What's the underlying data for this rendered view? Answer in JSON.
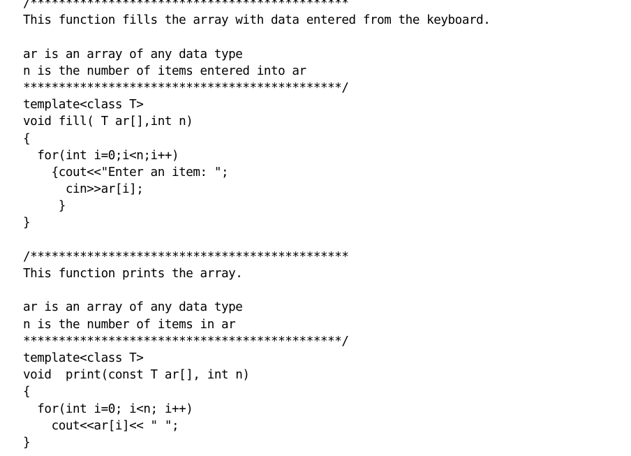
{
  "document": {
    "kind": "source-code-listing",
    "language": "C++",
    "background_color": "#ffffff",
    "text_color": "#000000",
    "lines": [
      "/*********************************************",
      "This function fills the array with data entered from the keyboard.",
      "",
      "ar is an array of any data type",
      "n is the number of items entered into ar",
      "*********************************************/",
      "template<class T>",
      "void fill( T ar[],int n)",
      "{",
      "  for(int i=0;i<n;i++)",
      "    {cout<<\"Enter an item: \";",
      "      cin>>ar[i];",
      "     }",
      "}",
      "",
      "/*********************************************",
      "This function prints the array.",
      "",
      "ar is an array of any data type",
      "n is the number of items in ar",
      "*********************************************/",
      "template<class T>",
      "void  print(const T ar[], int n)",
      "{",
      "  for(int i=0; i<n; i++)",
      "    cout<<ar[i]<< \" \";",
      "}"
    ]
  }
}
